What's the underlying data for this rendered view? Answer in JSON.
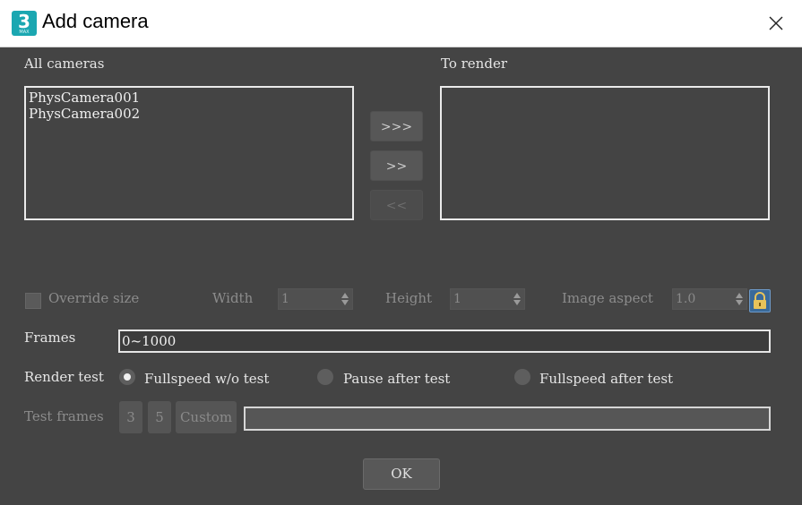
{
  "window": {
    "app_icon_text": "3",
    "app_icon_subtext": "MAX",
    "title": "Add camera"
  },
  "lists": {
    "all_cameras_label": "All cameras",
    "to_render_label": "To render",
    "all_cameras_items": [
      "PhysCamera001",
      "PhysCamera002"
    ],
    "to_render_items": []
  },
  "buttons": {
    "add_all": ">>>",
    "add_selected": ">>",
    "remove_selected": "<<",
    "ok": "OK"
  },
  "size": {
    "override_label": "Override size",
    "width_label": "Width",
    "width_value": "1",
    "height_label": "Height",
    "height_value": "1",
    "aspect_label": "Image aspect",
    "aspect_value": "1.0"
  },
  "frames": {
    "label": "Frames",
    "value": "0~1000"
  },
  "render_test": {
    "label": "Render test",
    "options": [
      "Fullspeed w/o test",
      "Pause after test",
      "Fullspeed after test"
    ],
    "selected": "Fullspeed w/o test"
  },
  "test_frames": {
    "label": "Test frames",
    "preset_3": "3",
    "preset_5": "5",
    "custom": "Custom",
    "value": ""
  },
  "colors": {
    "background": "#444444",
    "titlebar": "#ffffff",
    "lock_accent": "#3a6a9a"
  }
}
